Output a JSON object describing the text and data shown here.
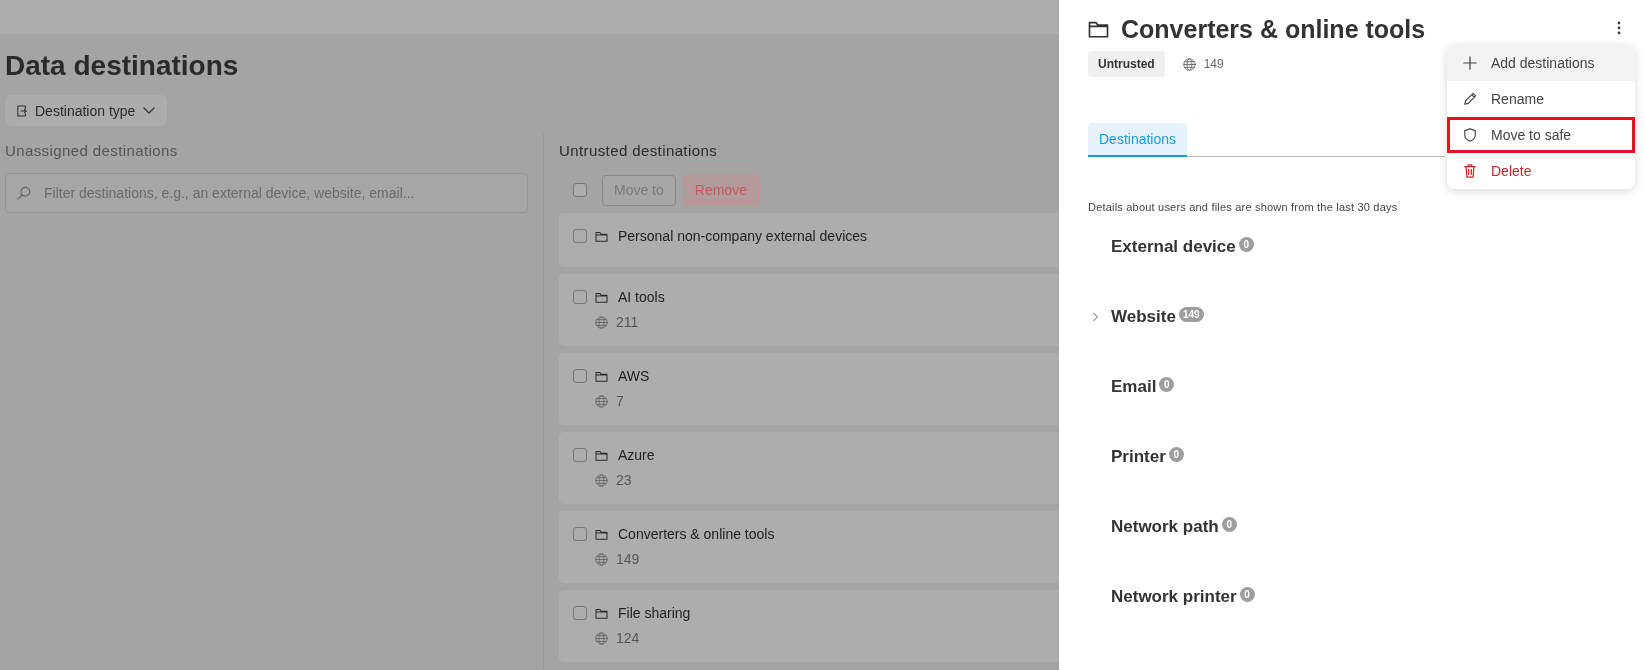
{
  "page": {
    "title": "Data destinations",
    "filter_button": "Destination type"
  },
  "unassigned": {
    "heading": "Unassigned destinations",
    "search": {
      "placeholder": "Filter destinations, e.g., an external device, website, email..."
    }
  },
  "untrusted": {
    "heading": "Untrusted destinations",
    "select_all": {
      "checked": false
    },
    "actions": [
      {
        "label": "Move to",
        "kind": "neutral"
      },
      {
        "label": "Remove",
        "kind": "danger"
      }
    ],
    "groups": [
      {
        "name": "Personal non-company external devices",
        "checked": false
      },
      {
        "name": "AI tools",
        "count": "211",
        "checked": false
      },
      {
        "name": "AWS",
        "count": "7",
        "checked": false
      },
      {
        "name": "Azure",
        "count": "23",
        "checked": false
      },
      {
        "name": "Converters & online tools",
        "count": "149",
        "checked": false
      },
      {
        "name": "File sharing",
        "count": "124",
        "checked": false
      }
    ]
  },
  "panel": {
    "title": "Converters & online tools",
    "badge": "Untrusted",
    "count": "149",
    "tabs": [
      {
        "label": "Destinations",
        "selected": true
      }
    ],
    "note": "Details about users and files are shown from the last 30 days",
    "categories": [
      {
        "name": "External device",
        "count": "0"
      },
      {
        "name": "Website",
        "count": "149",
        "expanded": false
      },
      {
        "name": "Email",
        "count": "0"
      },
      {
        "name": "Printer",
        "count": "0"
      },
      {
        "name": "Network path",
        "count": "0"
      },
      {
        "name": "Network printer",
        "count": "0"
      }
    ],
    "menu": [
      {
        "label": "Add destinations",
        "kind": "add",
        "hovered": true,
        "highlighted": false
      },
      {
        "label": "Rename",
        "kind": "rename",
        "hovered": false,
        "highlighted": false
      },
      {
        "label": "Move to safe",
        "kind": "safe",
        "hovered": false,
        "highlighted": true
      },
      {
        "label": "Delete",
        "kind": "delete",
        "hovered": false,
        "highlighted": false
      }
    ]
  }
}
